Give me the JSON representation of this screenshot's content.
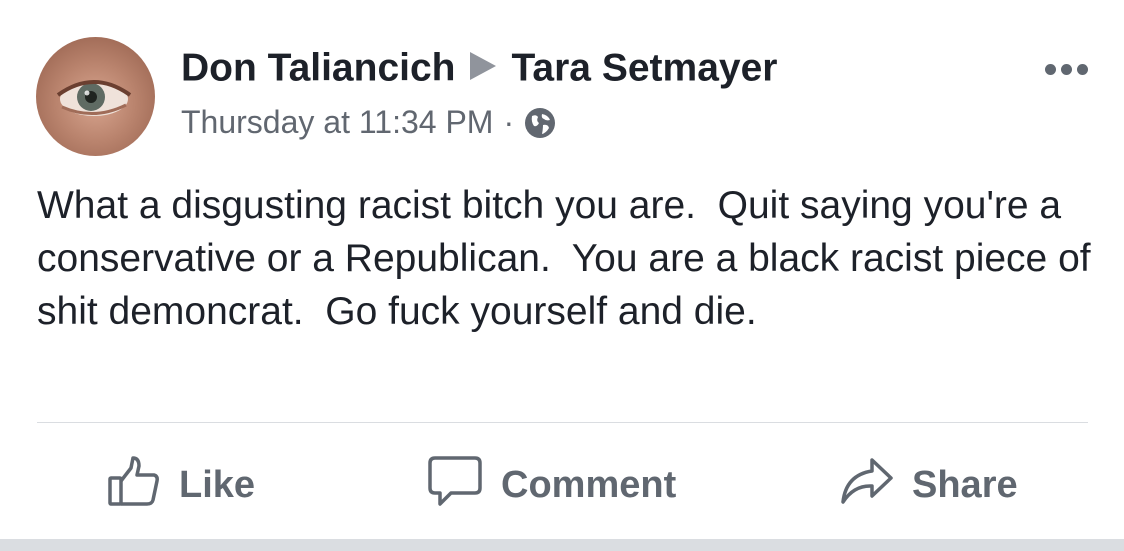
{
  "post": {
    "author": "Don Taliancich",
    "recipient": "Tara Setmayer",
    "timestamp": "Thursday at 11:34 PM",
    "separator": "·",
    "privacy_icon": "globe-icon",
    "text": "What a disgusting racist bitch you are.  Quit saying you're a conservative or a Republican.  You are a black racist piece of shit demoncrat.  Go fuck yourself and die."
  },
  "actions": {
    "like_label": "Like",
    "comment_label": "Comment",
    "share_label": "Share"
  },
  "colors": {
    "text": "#1d2129",
    "secondary": "#616770",
    "divider": "#dadde1"
  }
}
